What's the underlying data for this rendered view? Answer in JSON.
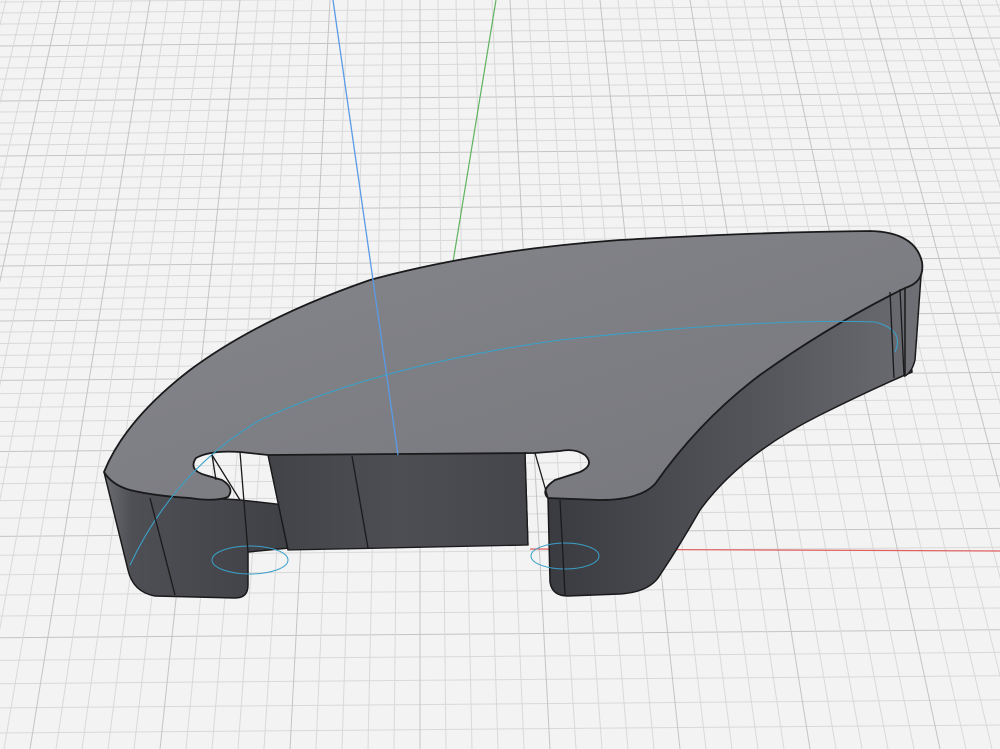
{
  "viewport": {
    "background_color": "#f3f3f3",
    "grid_minor_color": "#d9d9d9",
    "grid_major_color": "#c4c4c4"
  },
  "axes": {
    "x_color": "#e06060",
    "y_color": "#5fb35f",
    "z_color": "#5a9ae6"
  },
  "model": {
    "body_color": "#5a5b60",
    "top_face_color": "#7c7d82",
    "outline_color": "#1a1a1c",
    "sketch_curve_color": "#3aa0c8"
  }
}
